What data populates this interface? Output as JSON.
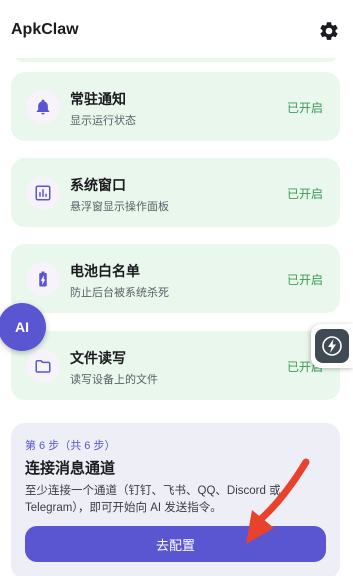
{
  "app": {
    "title": "ApkClaw",
    "settings_icon": "gear-icon"
  },
  "permissions": [
    {
      "icon": "bell-icon",
      "title": "常驻通知",
      "subtitle": "显示运行状态",
      "status": "已开启"
    },
    {
      "icon": "window-panel-icon",
      "title": "系统窗口",
      "subtitle": "悬浮窗显示操作面板",
      "status": "已开启"
    },
    {
      "icon": "battery-charging-icon",
      "title": "电池白名单",
      "subtitle": "防止后台被系统杀死",
      "status": "已开启"
    },
    {
      "icon": "folder-icon",
      "title": "文件读写",
      "subtitle": "读写设备上的文件",
      "status": "已开启"
    }
  ],
  "floating": {
    "ai_label": "AI"
  },
  "step": {
    "label": "第 6 步（共 6 步）",
    "title": "连接消息通道",
    "description": "至少连接一个通道（钉钉、飞书、QQ、Discord 或 Telegram），即可开始向 AI 发送指令。",
    "button_label": "去配置"
  },
  "colors": {
    "accent": "#5a55d0",
    "card_bg": "#e9f7ec",
    "status_green": "#3a9b57",
    "panel_bg": "#eeeef7",
    "annotation_arrow": "#e8422d"
  }
}
